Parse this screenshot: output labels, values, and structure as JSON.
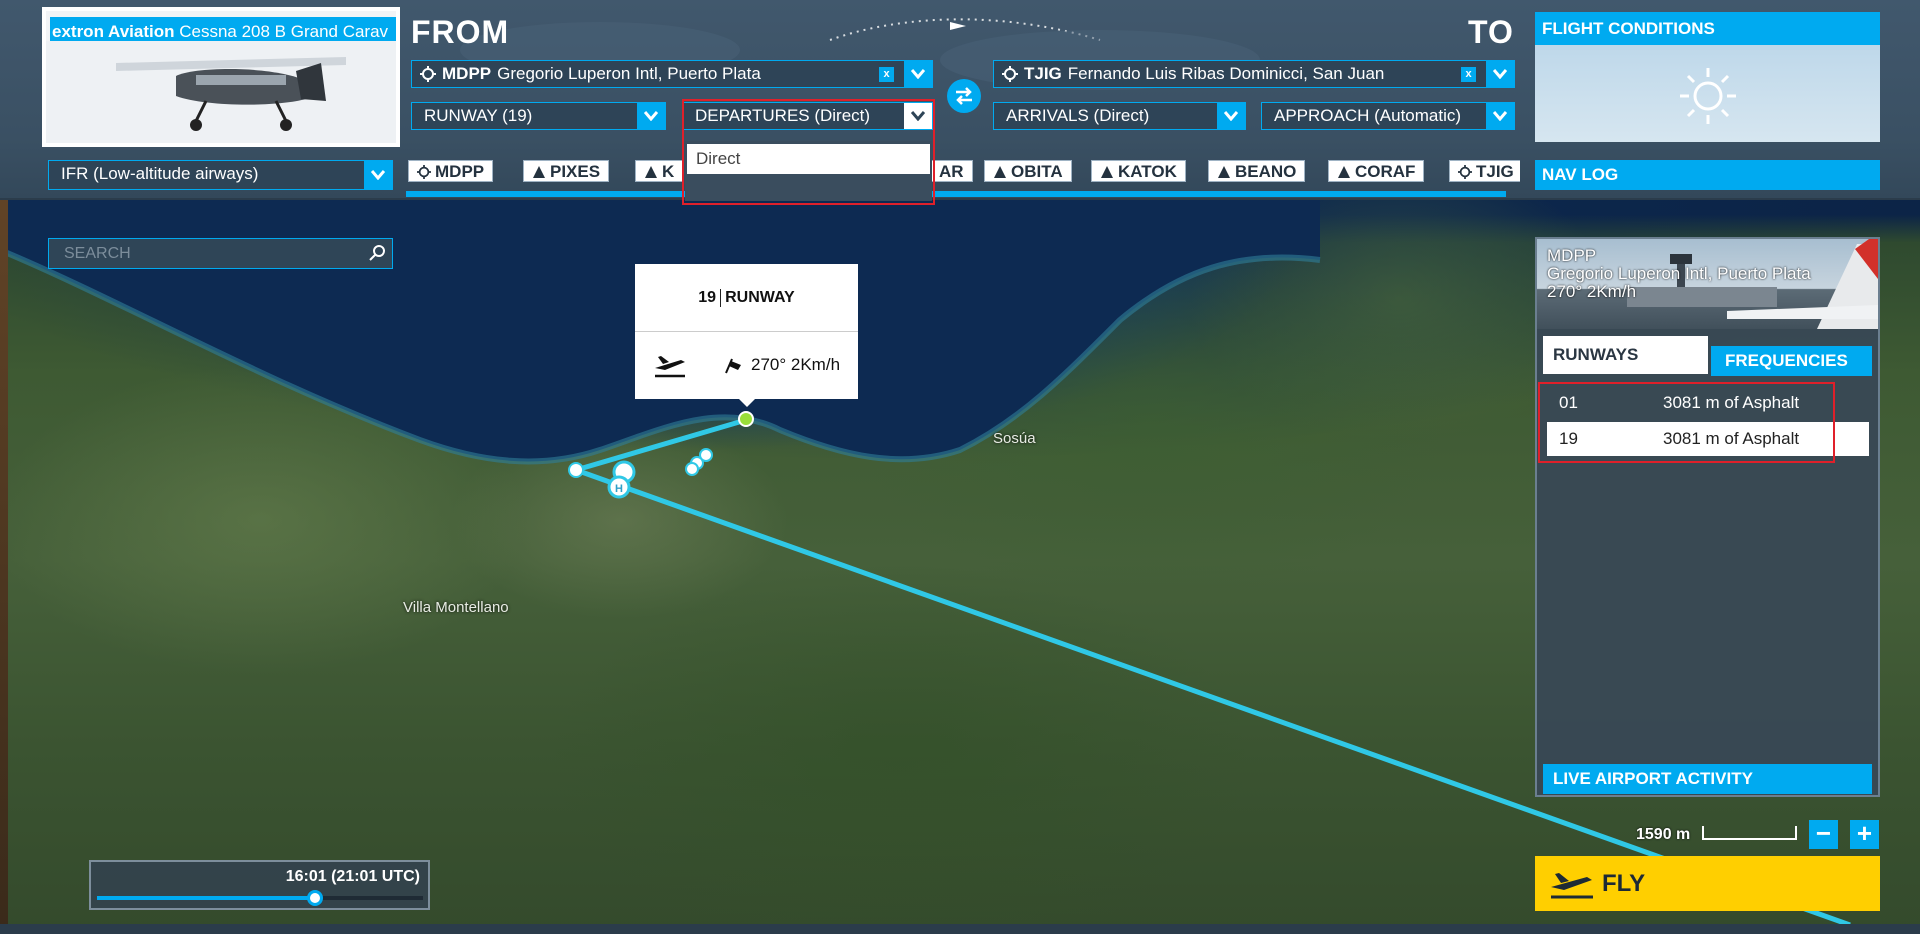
{
  "aircraft": {
    "manufacturer": "extron Aviation",
    "model": "Cessna 208 B Grand Carav"
  },
  "route": {
    "from_label": "FROM",
    "to_label": "TO",
    "from_airport": {
      "code": "MDPP",
      "name": "Gregorio Luperon Intl, Puerto Plata"
    },
    "to_airport": {
      "code": "TJIG",
      "name": "Fernando Luis Ribas Dominicci, San Juan"
    },
    "clear_label": "x",
    "runway": "RUNWAY (19)",
    "departure": "DEPARTURES (Direct)",
    "arrival": "ARRIVALS (Direct)",
    "approach": "APPROACH (Automatic)",
    "departure_options": [
      "Direct"
    ],
    "flight_type": "IFR (Low-altitude airways)",
    "waypoints": [
      {
        "name": "MDPP",
        "icon": "airport-icon"
      },
      {
        "name": "PIXES",
        "icon": "triangle-icon"
      },
      {
        "name": "K",
        "icon": "triangle-icon"
      },
      {
        "name": "AR",
        "icon": "triangle-icon"
      },
      {
        "name": "OBITA",
        "icon": "triangle-icon"
      },
      {
        "name": "KATOK",
        "icon": "triangle-icon"
      },
      {
        "name": "BEANO",
        "icon": "triangle-icon"
      },
      {
        "name": "CORAF",
        "icon": "triangle-icon"
      },
      {
        "name": "TJIG",
        "icon": "airport-icon"
      }
    ]
  },
  "flight_conditions": {
    "title": "FLIGHT CONDITIONS",
    "weather_icon": "sun-icon"
  },
  "navlog": {
    "label": "NAV LOG"
  },
  "search": {
    "placeholder": "SEARCH"
  },
  "runway_tooltip": {
    "number": "19",
    "label": "RUNWAY",
    "wind": "270° 2Km/h"
  },
  "map": {
    "labels": [
      "Sosúa",
      "Villa Montellano"
    ]
  },
  "airport_panel": {
    "code": "MDPP",
    "name": "Gregorio Luperon Intl, Puerto Plata",
    "wind": "270° 2Km/h",
    "tabs": [
      "RUNWAYS",
      "FREQUENCIES"
    ],
    "runways": [
      {
        "id": "01",
        "desc": "3081 m of Asphalt"
      },
      {
        "id": "19",
        "desc": "3081 m of Asphalt"
      }
    ],
    "live_activity": "LIVE AIRPORT ACTIVITY"
  },
  "scale": {
    "label": "1590 m"
  },
  "zoom": {
    "minus": "−",
    "plus": "+"
  },
  "fly": {
    "label": "FLY"
  },
  "time": {
    "label": "16:01 (21:01 UTC)",
    "progress": 0.67
  },
  "colors": {
    "accent": "#00aaf0",
    "fly": "#ffcf00",
    "route": "#30c8e6",
    "highlight": "#e0202a"
  }
}
